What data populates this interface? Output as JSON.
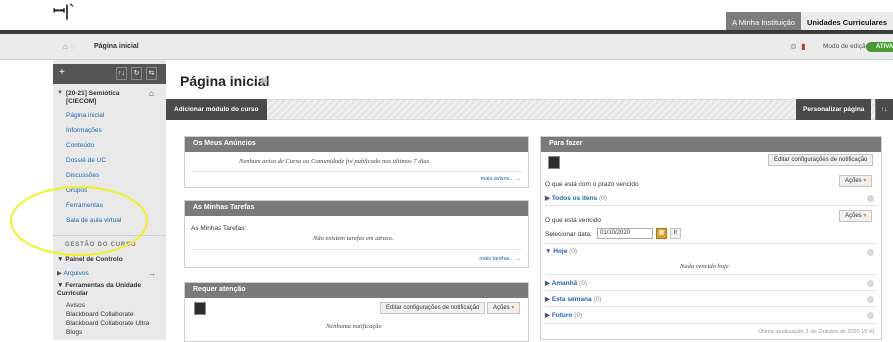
{
  "top": {
    "logo": "ꟷ|ˋ",
    "tabs": [
      "A Minha Instituição",
      "Unidades Curriculares"
    ]
  },
  "breadcrumb": {
    "home_icon": "⌂ ◌",
    "current": "Página inicial",
    "edit_mode_label": "Modo de edição",
    "edit_mode_value": "ATIVADO"
  },
  "sidebar": {
    "toolbar_plus": "+",
    "toolbar_icons": [
      "↑↓",
      "↻",
      "⇆"
    ],
    "course": "[20-21] Semiótica [CIECOM]",
    "links": [
      "Página inicial",
      "Informações",
      "Conteúdo",
      "Dossiê de UC",
      "Discussões",
      "Grupos",
      "Ferramentas",
      "Sala de aula virtual"
    ],
    "section_title": "GESTÃO DO CURSO",
    "control_panel": "Painel de Controlo",
    "files": "Arquivos",
    "tools_group": "Ferramentas da Unidade Curricular",
    "tools": [
      "Avisos",
      "Blackboard Collaborate",
      "Blackboard Collaborate Ultra",
      "Blogs"
    ]
  },
  "main": {
    "title": "Página inicial",
    "add_module": "Adicionar módulo do curso",
    "personalize": "Personalizar página",
    "extra": "↑↓"
  },
  "announcements": {
    "title": "Os Meus Anúncios",
    "empty": "Nenhum aviso de Curso ou Comunidade foi publicado nos últimos 7 dias.",
    "more": "mais avisos... →"
  },
  "tasks": {
    "title": "As Minhas Tarefas",
    "label": "As Minhas Tarefas:",
    "empty": "Não existem tarefas em atraso.",
    "more": "mais tarefas... →"
  },
  "attention": {
    "title": "Requer atenção",
    "edit_notif": "Editar configurações de notificação",
    "actions": "Ações",
    "empty": "Nenhuma notificação"
  },
  "todo": {
    "title": "Para fazer",
    "edit_notif": "Editar configurações de notificação",
    "actions": "Ações",
    "due_title": "O que está com o prazo vencido",
    "all_items": "Todos os itens",
    "all_items_count": "(0)",
    "overdue_title": "O que está vencido",
    "select_date_label": "Selecionar data:",
    "date_value": "01/10/2020",
    "go": "Ir",
    "today": "Hoje",
    "today_count": "(0)",
    "today_empty": "Nada vencido hoje",
    "tomorrow": "Amanhã",
    "tomorrow_count": "(0)",
    "this_week": "Esta semana",
    "this_week_count": "(0)",
    "future": "Futuro",
    "future_count": "(0)",
    "last_update": "Última atualização: 1 de Outubro de 2020 15:41"
  }
}
